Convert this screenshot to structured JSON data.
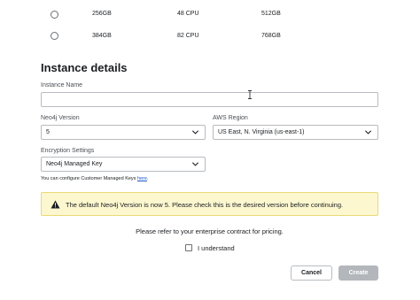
{
  "tiers": [
    {
      "memory": "256GB",
      "cpu": "48 CPU",
      "storage": "512GB"
    },
    {
      "memory": "384GB",
      "cpu": "82 CPU",
      "storage": "768GB"
    }
  ],
  "instance_details": {
    "title": "Instance details",
    "name_label": "Instance Name",
    "name_value": "",
    "version_label": "Neo4j Version",
    "version_value": "5",
    "region_label": "AWS Region",
    "region_value": "US East, N. Virginia (us-east-1)",
    "encryption_label": "Encryption Settings",
    "encryption_value": "Neo4j Managed Key",
    "helper_text": "You can configure Customer Managed Keys ",
    "helper_link": "here",
    "helper_end": "."
  },
  "banner": {
    "text": "The default Neo4j Version is now 5. Please check this is the desired version before continuing."
  },
  "pricing_text": "Please refer to your enterprise contract for pricing.",
  "understand_label": "I understand",
  "buttons": {
    "cancel": "Cancel",
    "create": "Create"
  }
}
